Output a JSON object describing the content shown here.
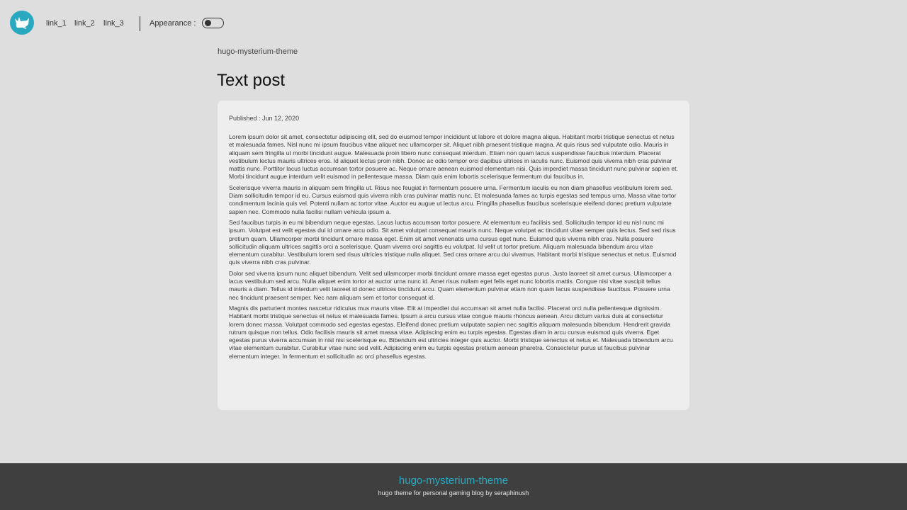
{
  "header": {
    "logo_icon": "cat-logo-icon",
    "links": [
      "link_1",
      "link_2",
      "link_3"
    ],
    "appearance_label": "Appearance :",
    "toggle_state": "off"
  },
  "main": {
    "site_name": "hugo-mysterium-theme",
    "title": "Text post",
    "published": "Published : Jun 12, 2020",
    "paragraphs": [
      "Lorem ipsum dolor sit amet, consectetur adipiscing elit, sed do eiusmod tempor incididunt ut labore et dolore magna aliqua. Habitant morbi tristique senectus et netus et malesuada fames. Nisl nunc mi ipsum faucibus vitae aliquet nec ullamcorper sit. Aliquet nibh praesent tristique magna. At quis risus sed vulputate odio. Mauris in aliquam sem fringilla ut morbi tincidunt augue. Malesuada proin libero nunc consequat interdum. Etiam non quam lacus suspendisse faucibus interdum. Placerat vestibulum lectus mauris ultrices eros. Id aliquet lectus proin nibh. Donec ac odio tempor orci dapibus ultrices in iaculis nunc. Euismod quis viverra nibh cras pulvinar mattis nunc. Porttitor lacus luctus accumsan tortor posuere ac. Neque ornare aenean euismod elementum nisi. Quis imperdiet massa tincidunt nunc pulvinar sapien et. Morbi tincidunt augue interdum velit euismod in pellentesque massa. Diam quis enim lobortis scelerisque fermentum dui faucibus in.",
      "Scelerisque viverra mauris in aliquam sem fringilla ut. Risus nec feugiat in fermentum posuere urna. Fermentum iaculis eu non diam phasellus vestibulum lorem sed. Diam sollicitudin tempor id eu. Cursus euismod quis viverra nibh cras pulvinar mattis nunc. Et malesuada fames ac turpis egestas sed tempus urna. Massa vitae tortor condimentum lacinia quis vel. Potenti nullam ac tortor vitae. Auctor eu augue ut lectus arcu. Fringilla phasellus faucibus scelerisque eleifend donec pretium vulputate sapien nec. Commodo nulla facilisi nullam vehicula ipsum a.",
      "Sed faucibus turpis in eu mi bibendum neque egestas. Lacus luctus accumsan tortor posuere. At elementum eu facilisis sed. Sollicitudin tempor id eu nisl nunc mi ipsum. Volutpat est velit egestas dui id ornare arcu odio. Sit amet volutpat consequat mauris nunc. Neque volutpat ac tincidunt vitae semper quis lectus. Sed sed risus pretium quam. Ullamcorper morbi tincidunt ornare massa eget. Enim sit amet venenatis urna cursus eget nunc. Euismod quis viverra nibh cras. Nulla posuere sollicitudin aliquam ultrices sagittis orci a scelerisque. Quam viverra orci sagittis eu volutpat. Id velit ut tortor pretium. Aliquam malesuada bibendum arcu vitae elementum curabitur. Vestibulum lorem sed risus ultricies tristique nulla aliquet. Sed cras ornare arcu dui vivamus. Habitant morbi tristique senectus et netus. Euismod quis viverra nibh cras pulvinar.",
      "Dolor sed viverra ipsum nunc aliquet bibendum. Velit sed ullamcorper morbi tincidunt ornare massa eget egestas purus. Justo laoreet sit amet cursus. Ullamcorper a lacus vestibulum sed arcu. Nulla aliquet enim tortor at auctor urna nunc id. Amet risus nullam eget felis eget nunc lobortis mattis. Congue nisi vitae suscipit tellus mauris a diam. Tellus id interdum velit laoreet id donec ultrices tincidunt arcu. Quam elementum pulvinar etiam non quam lacus suspendisse faucibus. Posuere urna nec tincidunt praesent semper. Nec nam aliquam sem et tortor consequat id.",
      "Magnis dis parturient montes nascetur ridiculus mus mauris vitae. Elit at imperdiet dui accumsan sit amet nulla facilisi. Placerat orci nulla pellentesque dignissim. Habitant morbi tristique senectus et netus et malesuada fames. Ipsum a arcu cursus vitae congue mauris rhoncus aenean. Arcu dictum varius duis at consectetur lorem donec massa. Volutpat commodo sed egestas egestas. Eleifend donec pretium vulputate sapien nec sagittis aliquam malesuada bibendum. Hendrerit gravida rutrum quisque non tellus. Odio facilisis mauris sit amet massa vitae. Adipiscing enim eu turpis egestas. Egestas diam in arcu cursus euismod quis viverra. Eget egestas purus viverra accumsan in nisl nisi scelerisque eu. Bibendum est ultricies integer quis auctor. Morbi tristique senectus et netus et. Malesuada bibendum arcu vitae elementum curabitur. Curabitur vitae nunc sed velit. Adipiscing enim eu turpis egestas pretium aenean pharetra. Consectetur purus ut faucibus pulvinar elementum integer. In fermentum et sollicitudin ac orci phasellus egestas."
    ]
  },
  "footer": {
    "title": "hugo-mysterium-theme",
    "subtitle": "hugo theme for personal gaming blog by seraphinush"
  },
  "colors": {
    "accent": "#2aa8bf",
    "background": "#dedede",
    "card": "#eeeeee",
    "footer": "#3f3f3f"
  }
}
